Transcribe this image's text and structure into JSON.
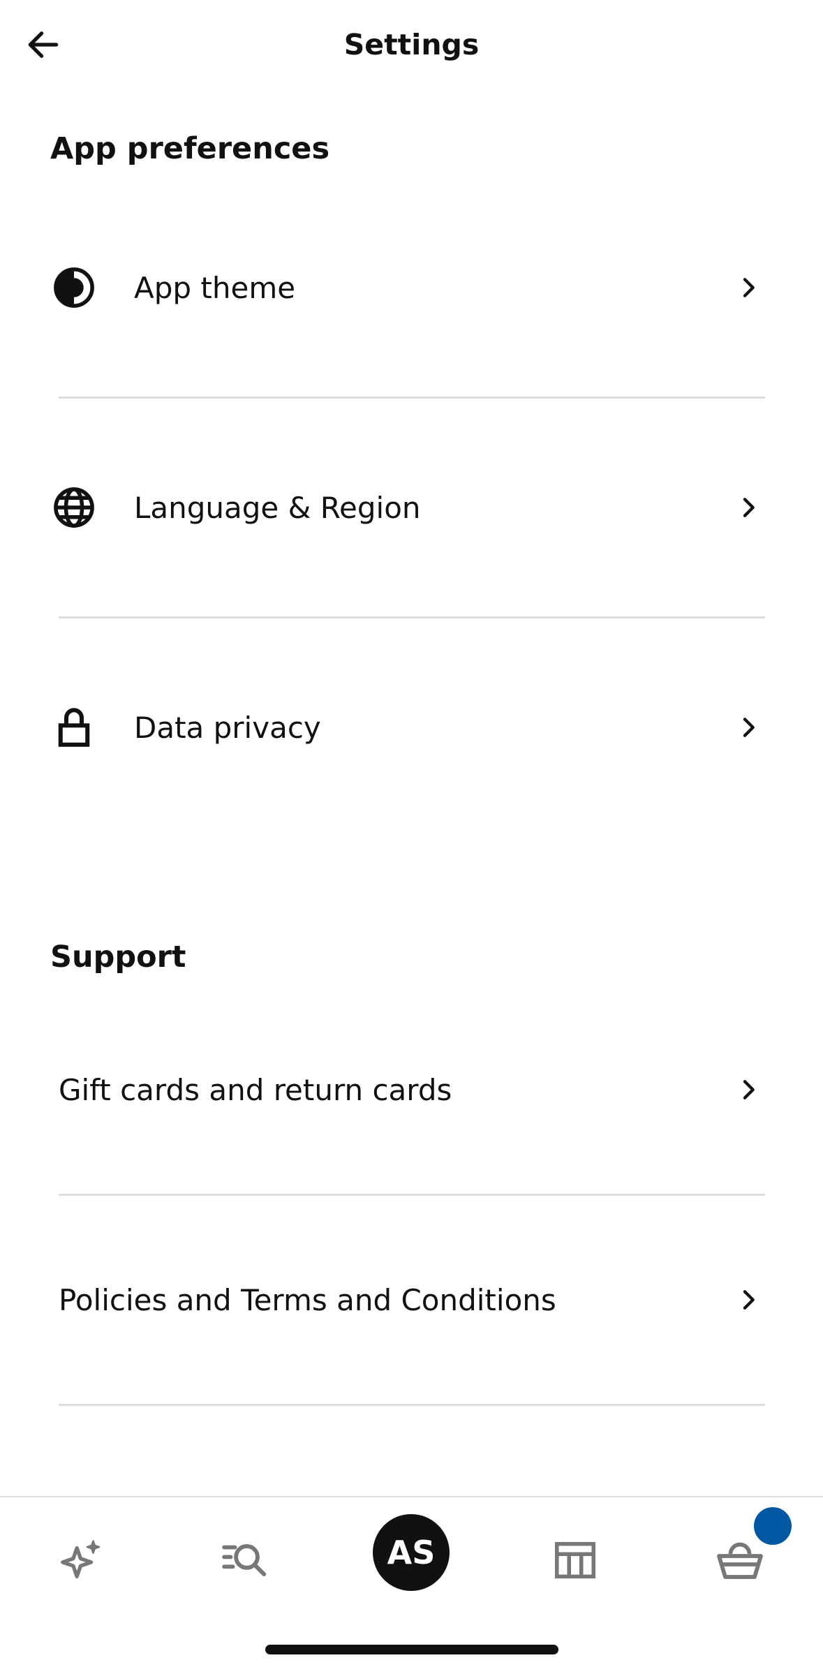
{
  "header": {
    "title": "Settings"
  },
  "sections": [
    {
      "title": "App preferences",
      "items": [
        {
          "label": "App theme",
          "icon": "contrast-icon"
        },
        {
          "label": "Language & Region",
          "icon": "globe-icon"
        },
        {
          "label": "Data privacy",
          "icon": "lock-icon"
        }
      ]
    },
    {
      "title": "Support",
      "items": [
        {
          "label": "Gift cards and return cards"
        },
        {
          "label": "Policies and Terms and Conditions"
        }
      ]
    }
  ],
  "bottom_nav": {
    "items": [
      "inspiration-icon",
      "search-icon",
      "profile-avatar",
      "store-icon",
      "basket-icon"
    ],
    "avatar_initials": "AS",
    "badge_color": "#0058a3"
  }
}
